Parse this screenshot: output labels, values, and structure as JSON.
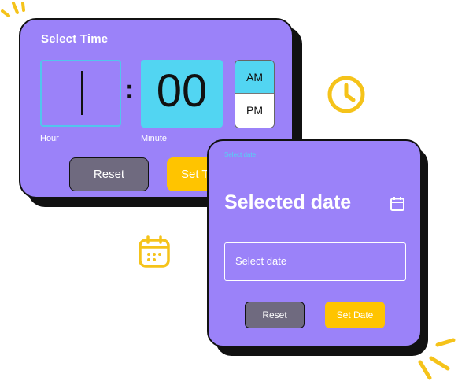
{
  "time_picker": {
    "title": "Select Time",
    "hour_label": "Hour",
    "minute_label": "Minute",
    "minute_value": "00",
    "separator": ":",
    "am_label": "AM",
    "pm_label": "PM",
    "reset_label": "Reset",
    "set_label": "Set T"
  },
  "date_picker": {
    "small_label": "Select date",
    "title": "Selected date",
    "input_placeholder": "Select date",
    "reset_label": "Reset",
    "set_label": "Set Date"
  },
  "decor": {
    "clock_icon": "clock-icon",
    "calendar_icon": "calendar-icon",
    "accent_color": "#f5c31a"
  }
}
